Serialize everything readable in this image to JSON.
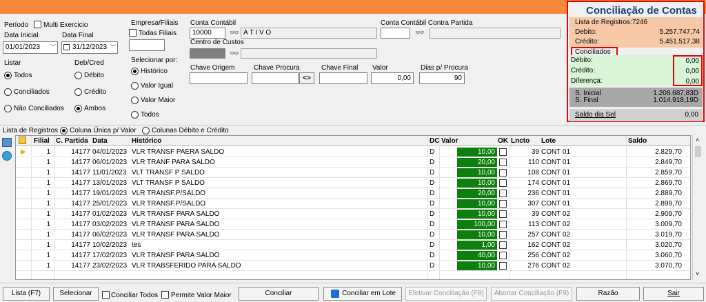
{
  "filters": {
    "periodo_label": "Período",
    "multi_exercicio_label": "Multi Exercicio",
    "data_inicial_label": "Data Inicial",
    "data_final_label": "Data Final",
    "data_inicial": "01/01/2023",
    "data_final": "31/12/2023",
    "empresa_label": "Empresa/Filiais",
    "todas_filiais_label": "Todas Filiais",
    "conta_contabil_label": "Conta Contábil",
    "conta_contabil": "10000",
    "conta_desc": "A T I V O",
    "centro_custos_label": "Centro de Custos",
    "contra_partida_label": "Conta Contábil Contra Partida",
    "listar_label": "Listar",
    "listar_options": [
      "Todos",
      "Conciliados",
      "Não Conciliados"
    ],
    "debcred_label": "Deb/Cred",
    "debcred_options": [
      "Débito",
      "Crédito",
      "Ambos"
    ],
    "selecionar_por_label": "Selecionar por:",
    "selecionar_options": [
      "Histórico",
      "Valor Igual",
      "Valor Maior",
      "Todos"
    ],
    "chave_origem_label": "Chave Origem",
    "chave_procura_label": "Chave Procura",
    "chave_final_label": "Chave Final",
    "valor_label": "Valor",
    "valor": "0,00",
    "dias_label": "Dias p/ Procura",
    "dias": "90"
  },
  "summary": {
    "title": "Conciliação de Contas",
    "lista_registros": "Lista de Registros:7246",
    "debito_label": "Debito:",
    "debito": "5.257.747,74",
    "credito_label": "Crédito:",
    "credito": "5.451.517,38",
    "conciliados_label": "Conciliados",
    "c_debito_label": "Débito:",
    "c_debito": "0,00",
    "c_credito_label": "Crédito:",
    "c_credito": "0,00",
    "c_diferenca_label": "Diferença:",
    "c_diferenca": "0,00",
    "s_inicial_label": "S. Inicial",
    "s_inicial": "1.208.687,83D",
    "s_final_label": "S. Final",
    "s_final": "1.014.918,19D",
    "saldo_dia_label": "Saldo dia Sel",
    "saldo_dia": "0,00"
  },
  "list_options": {
    "label": "Lista de Registros",
    "opt1": "Coluna Única p/ Valor",
    "opt2": "Colunas Débito e Crédito"
  },
  "table": {
    "headers": [
      "Filial",
      "C. Partida",
      "Data",
      "Histórico",
      "DC",
      "Valor",
      "OK",
      "Lncto",
      "Lote",
      "Saldo"
    ],
    "rows": [
      {
        "filial": "1",
        "cpartida": "14177",
        "data": "04/01/2023",
        "historico": "VLR TRANSF PAERA SALDO",
        "dc": "D",
        "valor": "10,00",
        "lncto": "39",
        "lote": "CONT 01",
        "saldo": "2.829,70"
      },
      {
        "filial": "1",
        "cpartida": "14177",
        "data": "06/01/2023",
        "historico": "VLR TRANF PARA SALDO",
        "dc": "D",
        "valor": "20,00",
        "lncto": "110",
        "lote": "CONT 01",
        "saldo": "2.849,70"
      },
      {
        "filial": "1",
        "cpartida": "14177",
        "data": "11/01/2023",
        "historico": "VLT TRANSF P SALDO",
        "dc": "D",
        "valor": "10,00",
        "lncto": "108",
        "lote": "CONT 01",
        "saldo": "2.859,70"
      },
      {
        "filial": "1",
        "cpartida": "14177",
        "data": "13/01/2023",
        "historico": "VLT TRANSF P SALDO",
        "dc": "D",
        "valor": "10,00",
        "lncto": "174",
        "lote": "CONT 01",
        "saldo": "2.869,70"
      },
      {
        "filial": "1",
        "cpartida": "14177",
        "data": "19/01/2023",
        "historico": "VLR TRANSF.P/SALDO",
        "dc": "D",
        "valor": "20,00",
        "lncto": "236",
        "lote": "CONT 01",
        "saldo": "2.889,70"
      },
      {
        "filial": "1",
        "cpartida": "14177",
        "data": "25/01/2023",
        "historico": "VLR TRANSF.P/SALDO",
        "dc": "D",
        "valor": "10,00",
        "lncto": "307",
        "lote": "CONT 01",
        "saldo": "2.899,70"
      },
      {
        "filial": "1",
        "cpartida": "14177",
        "data": "01/02/2023",
        "historico": "VLR TRANSF PARA SALDO",
        "dc": "D",
        "valor": "10,00",
        "lncto": "39",
        "lote": "CONT 02",
        "saldo": "2.909,70"
      },
      {
        "filial": "1",
        "cpartida": "14177",
        "data": "03/02/2023",
        "historico": "VLR TRANSF PARA SALDO",
        "dc": "D",
        "valor": "100,00",
        "lncto": "113",
        "lote": "CONT 02",
        "saldo": "3.009,70"
      },
      {
        "filial": "1",
        "cpartida": "14177",
        "data": "06/02/2023",
        "historico": "VLR TRANSF PARA SALDO",
        "dc": "D",
        "valor": "10,00",
        "lncto": "257",
        "lote": "CONT 02",
        "saldo": "3.019,70"
      },
      {
        "filial": "1",
        "cpartida": "14177",
        "data": "10/02/2023",
        "historico": "tes",
        "dc": "D",
        "valor": "1,00",
        "lncto": "162",
        "lote": "CONT 02",
        "saldo": "3.020,70"
      },
      {
        "filial": "1",
        "cpartida": "14177",
        "data": "17/02/2023",
        "historico": "VLR TRANSF PARA SALDO",
        "dc": "D",
        "valor": "40,00",
        "lncto": "256",
        "lote": "CONT 02",
        "saldo": "3.060,70"
      },
      {
        "filial": "1",
        "cpartida": "14177",
        "data": "23/02/2023",
        "historico": "VLR TRABSFERIDO PARA SALDO",
        "dc": "D",
        "valor": "10,00",
        "lncto": "276",
        "lote": "CONT 02",
        "saldo": "3.070,70"
      }
    ]
  },
  "buttons": {
    "lista": "Lista (F7)",
    "selecionar": "Selecionar",
    "conciliar_todos": "Conciliar Todos",
    "permite_valor_maior": "Permite Valor Maior",
    "conciliar": "Conciliar",
    "conciliar_lote": "Conciliar  em Lote",
    "efetivar": "Efetivar Conciliação (F8)",
    "abortar": "Abortar Conciliação (F9)",
    "razao": "Razão",
    "sair": "Sair"
  },
  "colors": {
    "topbar": "#f5883a",
    "highlight": "#e00000",
    "valor_cell": "#0c7f0c",
    "title": "#1f3f7a"
  }
}
